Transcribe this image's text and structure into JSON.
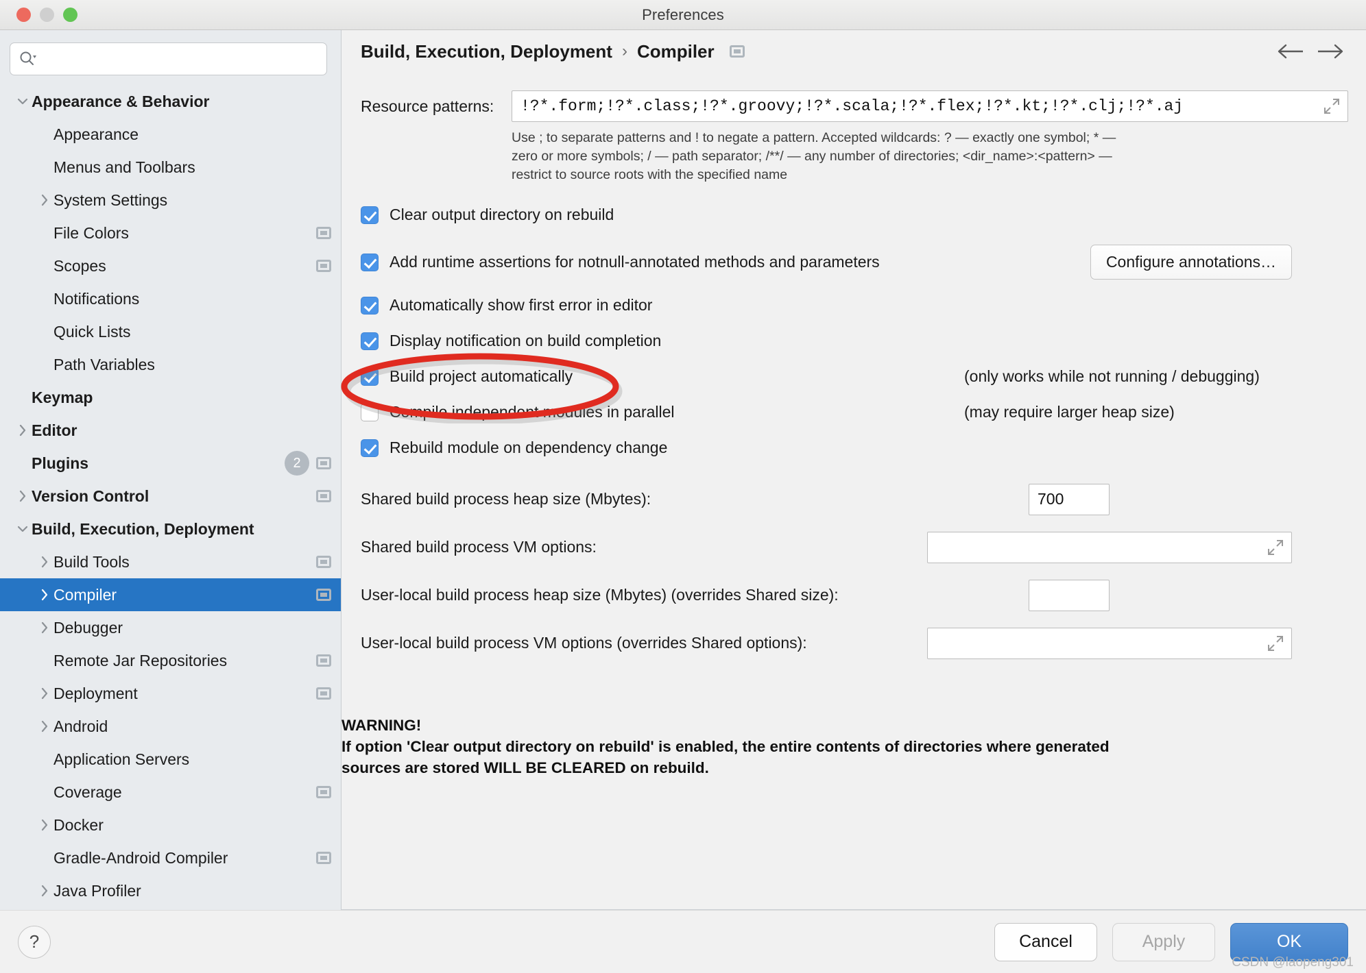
{
  "window": {
    "title": "Preferences",
    "traffic_lights": [
      "close-red",
      "minimize-gray",
      "zoom-green"
    ]
  },
  "sidebar": {
    "search": {
      "value": "",
      "placeholder": "",
      "icon": "search-icon"
    },
    "items": [
      {
        "label": "Appearance & Behavior",
        "depth": 0,
        "bold": true,
        "twisty": "down",
        "scope": false,
        "badge": null,
        "selected": false
      },
      {
        "label": "Appearance",
        "depth": 1,
        "bold": false,
        "twisty": "none",
        "scope": false,
        "badge": null,
        "selected": false
      },
      {
        "label": "Menus and Toolbars",
        "depth": 1,
        "bold": false,
        "twisty": "none",
        "scope": false,
        "badge": null,
        "selected": false
      },
      {
        "label": "System Settings",
        "depth": 1,
        "bold": false,
        "twisty": "right",
        "scope": false,
        "badge": null,
        "selected": false
      },
      {
        "label": "File Colors",
        "depth": 1,
        "bold": false,
        "twisty": "none",
        "scope": true,
        "badge": null,
        "selected": false
      },
      {
        "label": "Scopes",
        "depth": 1,
        "bold": false,
        "twisty": "none",
        "scope": true,
        "badge": null,
        "selected": false
      },
      {
        "label": "Notifications",
        "depth": 1,
        "bold": false,
        "twisty": "none",
        "scope": false,
        "badge": null,
        "selected": false
      },
      {
        "label": "Quick Lists",
        "depth": 1,
        "bold": false,
        "twisty": "none",
        "scope": false,
        "badge": null,
        "selected": false
      },
      {
        "label": "Path Variables",
        "depth": 1,
        "bold": false,
        "twisty": "none",
        "scope": false,
        "badge": null,
        "selected": false
      },
      {
        "label": "Keymap",
        "depth": 0,
        "bold": true,
        "twisty": "none",
        "scope": false,
        "badge": null,
        "selected": false
      },
      {
        "label": "Editor",
        "depth": 0,
        "bold": true,
        "twisty": "right",
        "scope": false,
        "badge": null,
        "selected": false
      },
      {
        "label": "Plugins",
        "depth": 0,
        "bold": true,
        "twisty": "none",
        "scope": true,
        "badge": "2",
        "selected": false
      },
      {
        "label": "Version Control",
        "depth": 0,
        "bold": true,
        "twisty": "right",
        "scope": true,
        "badge": null,
        "selected": false
      },
      {
        "label": "Build, Execution, Deployment",
        "depth": 0,
        "bold": true,
        "twisty": "down",
        "scope": false,
        "badge": null,
        "selected": false
      },
      {
        "label": "Build Tools",
        "depth": 1,
        "bold": false,
        "twisty": "right",
        "scope": true,
        "badge": null,
        "selected": false
      },
      {
        "label": "Compiler",
        "depth": 1,
        "bold": false,
        "twisty": "right",
        "scope": true,
        "badge": null,
        "selected": true
      },
      {
        "label": "Debugger",
        "depth": 1,
        "bold": false,
        "twisty": "right",
        "scope": false,
        "badge": null,
        "selected": false
      },
      {
        "label": "Remote Jar Repositories",
        "depth": 1,
        "bold": false,
        "twisty": "none",
        "scope": true,
        "badge": null,
        "selected": false
      },
      {
        "label": "Deployment",
        "depth": 1,
        "bold": false,
        "twisty": "right",
        "scope": true,
        "badge": null,
        "selected": false
      },
      {
        "label": "Android",
        "depth": 1,
        "bold": false,
        "twisty": "right",
        "scope": false,
        "badge": null,
        "selected": false
      },
      {
        "label": "Application Servers",
        "depth": 1,
        "bold": false,
        "twisty": "none",
        "scope": false,
        "badge": null,
        "selected": false
      },
      {
        "label": "Coverage",
        "depth": 1,
        "bold": false,
        "twisty": "none",
        "scope": true,
        "badge": null,
        "selected": false
      },
      {
        "label": "Docker",
        "depth": 1,
        "bold": false,
        "twisty": "right",
        "scope": false,
        "badge": null,
        "selected": false
      },
      {
        "label": "Gradle-Android Compiler",
        "depth": 1,
        "bold": false,
        "twisty": "none",
        "scope": true,
        "badge": null,
        "selected": false
      },
      {
        "label": "Java Profiler",
        "depth": 1,
        "bold": false,
        "twisty": "right",
        "scope": false,
        "badge": null,
        "selected": false
      }
    ]
  },
  "breadcrumb": {
    "root": "Build, Execution, Deployment",
    "separator": "›",
    "leaf": "Compiler",
    "back_icon": "arrow-left-icon",
    "forward_icon": "arrow-right-icon",
    "scope_icon": "project-scope-icon"
  },
  "main": {
    "resource_patterns": {
      "label": "Resource patterns:",
      "value": "!?*.form;!?*.class;!?*.groovy;!?*.scala;!?*.flex;!?*.kt;!?*.clj;!?*.aj",
      "expand_icon": "expand-editor-icon"
    },
    "hint_lines": [
      "Use ; to separate patterns and ! to negate a pattern. Accepted wildcards: ? — exactly one symbol; * —",
      "zero or more symbols; / — path separator; /**/ — any number of directories; <dir_name>:<pattern> —",
      "restrict to source roots with the specified name"
    ],
    "checkboxes": [
      {
        "label": "Clear output directory on rebuild",
        "checked": true,
        "note": ""
      },
      {
        "label": "Add runtime assertions for notnull-annotated methods and parameters",
        "checked": true,
        "note": ""
      },
      {
        "label": "Automatically show first error in editor",
        "checked": true,
        "note": ""
      },
      {
        "label": "Display notification on build completion",
        "checked": true,
        "note": ""
      },
      {
        "label": "Build project automatically",
        "checked": true,
        "note": "(only works while not running / debugging)"
      },
      {
        "label": "Compile independent modules in parallel",
        "checked": false,
        "note": "(may require larger heap size)"
      },
      {
        "label": "Rebuild module on dependency change",
        "checked": true,
        "note": ""
      }
    ],
    "configure_annotations_button": "Configure annotations…",
    "fields": [
      {
        "label": "Shared build process heap size (Mbytes):",
        "value": "700",
        "expandable": false,
        "wide": false
      },
      {
        "label": "Shared build process VM options:",
        "value": "",
        "expandable": true,
        "wide": true
      },
      {
        "label": "User-local build process heap size (Mbytes) (overrides Shared size):",
        "value": "",
        "expandable": false,
        "wide": false
      },
      {
        "label": "User-local build process VM options (overrides Shared options):",
        "value": "",
        "expandable": true,
        "wide": true
      }
    ],
    "warning_lines": [
      "WARNING!",
      "If option 'Clear output directory on rebuild' is enabled, the entire contents of directories where generated",
      "sources are stored WILL BE CLEARED on rebuild."
    ]
  },
  "footer": {
    "help_label": "?",
    "cancel": "Cancel",
    "apply": "Apply",
    "ok": "OK",
    "watermark": "CSDN @laopeng301"
  },
  "colors": {
    "selection_blue": "#2675c4",
    "checkbox_blue": "#4a94e8",
    "ok_button_blue": "#4382cb",
    "annotation_red": "#e02b20",
    "sidebar_bg": "#e8ebee",
    "detail_bg": "#f1f1f1"
  },
  "annotation": {
    "type": "ellipse",
    "target": "Build project automatically",
    "color": "#e02b20"
  }
}
